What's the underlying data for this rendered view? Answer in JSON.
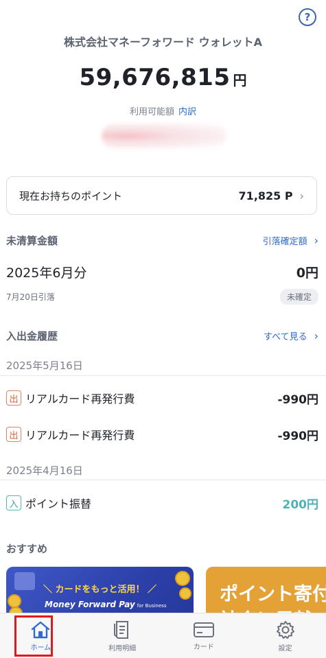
{
  "header": {
    "help_icon": "question-circle-icon",
    "help_glyph": "?",
    "wallet_name": "株式会社マネーフォワード ウォレットA"
  },
  "balance": {
    "amount": "59,676,815",
    "unit": "円",
    "label": "利用可能額",
    "detail_link": "内訳"
  },
  "points": {
    "label": "現在お持ちのポイント",
    "value": "71,825 P"
  },
  "unsettled": {
    "title": "未清算金額",
    "link": "引落確定額",
    "month": "2025年6月分",
    "amount": "0円",
    "due": "7月20日引落",
    "status": "未確定"
  },
  "history": {
    "title": "入出金履歴",
    "link": "すべて見る",
    "groups": [
      {
        "date": "2025年5月16日",
        "items": [
          {
            "badge": "出",
            "name": "リアルカード再発行費",
            "amount": "-990円",
            "type": "out"
          },
          {
            "badge": "出",
            "name": "リアルカード再発行費",
            "amount": "-990円",
            "type": "out"
          }
        ]
      },
      {
        "date": "2025年4月16日",
        "items": [
          {
            "badge": "入",
            "name": "ポイント振替",
            "amount": "200円",
            "type": "in"
          }
        ]
      }
    ]
  },
  "recommend": {
    "title": "おすすめ",
    "banner1_tagline": "＼ カードをもっと活用！ ／",
    "banner1_brand": "Money Forward Pay",
    "banner1_brand_sub": "for Business",
    "banner2_line1": "ポイント寄付",
    "banner2_line2": "社会に貢献"
  },
  "tabbar": {
    "tabs": [
      {
        "label": "ホーム",
        "icon": "home-icon"
      },
      {
        "label": "利用明細",
        "icon": "receipt-icon"
      },
      {
        "label": "カード",
        "icon": "card-icon"
      },
      {
        "label": "設定",
        "icon": "gear-icon"
      }
    ]
  },
  "colors": {
    "accent": "#2f6bd0",
    "out_badge": "#d5643c",
    "in_badge": "#3aa6a6",
    "highlight": "#e3161e"
  }
}
